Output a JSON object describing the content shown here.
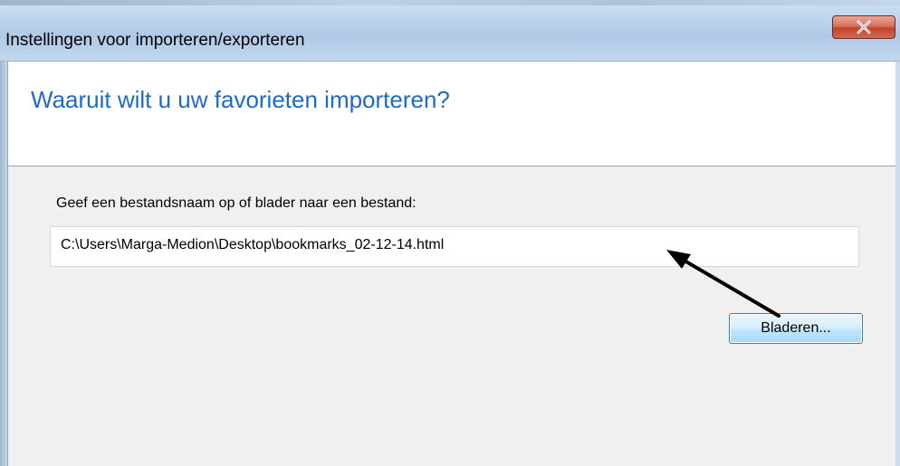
{
  "window": {
    "title": "Instellingen voor importeren/exporteren",
    "close_symbol": "X"
  },
  "header": {
    "heading": "Waaruit wilt u uw favorieten importeren?"
  },
  "form": {
    "prompt": "Geef een bestandsnaam op of blader naar een bestand:",
    "file_path": "C:\\Users\\Marga-Medion\\Desktop\\bookmarks_02-12-14.html",
    "browse_label": "Bladeren..."
  },
  "icons": {
    "close": "close-icon",
    "annotation": "arrow-icon"
  },
  "colors": {
    "heading": "#1e6bc4",
    "close_button": "#c4402a",
    "button_border": "#3c7fb1"
  }
}
